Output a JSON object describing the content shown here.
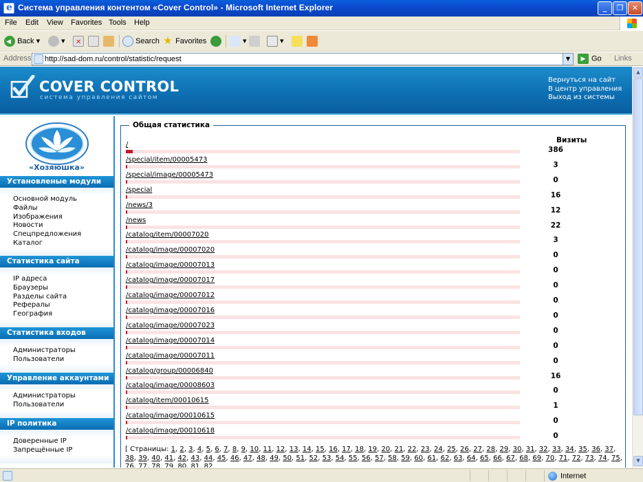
{
  "window": {
    "title": "Система управления контентом «Cover Control» - Microsoft Internet Explorer"
  },
  "menu": [
    "File",
    "Edit",
    "View",
    "Favorites",
    "Tools",
    "Help"
  ],
  "toolbar": {
    "back": "Back",
    "search": "Search",
    "favorites": "Favorites"
  },
  "address": {
    "label": "Address",
    "url": "http://sad-dom.ru/control/statistic/request",
    "go": "Go",
    "links": "Links"
  },
  "header": {
    "logo_title": "COVER CONTROL",
    "logo_subtitle": "система управления сайтом",
    "links": [
      "Вернуться на сайт",
      "В центр управления",
      "Выход из системы"
    ]
  },
  "sidebar": {
    "brand": "«Хозяюшка»",
    "sections": [
      {
        "title": "Установленые модули",
        "items": [
          "Основной модуль",
          "Файлы",
          "Изображения",
          "Новости",
          "Спецпредложения",
          "Каталог"
        ]
      },
      {
        "title": "Статистика сайта",
        "items": [
          "IP адреса",
          "Браузеры",
          "Разделы сайта",
          "Рефералы",
          "География"
        ]
      },
      {
        "title": "Статистика входов",
        "items": [
          "Администраторы",
          "Пользователи"
        ]
      },
      {
        "title": "Управление аккаунтами",
        "items": [
          "Администраторы",
          "Пользователи"
        ]
      },
      {
        "title": "IP политика",
        "items": [
          "Доверенные IP",
          "Запрещённые IP"
        ]
      }
    ]
  },
  "stats": {
    "title": "Общая статистика",
    "column": "Визиты",
    "max": 386,
    "rows": [
      {
        "path": "/",
        "visits": 386
      },
      {
        "path": "/special/item/00005473",
        "visits": 3
      },
      {
        "path": "/special/image/00005473",
        "visits": 0
      },
      {
        "path": "/special",
        "visits": 16
      },
      {
        "path": "/news/3",
        "visits": 12
      },
      {
        "path": "/news",
        "visits": 22
      },
      {
        "path": "/catalog/item/00007020",
        "visits": 3
      },
      {
        "path": "/catalog/image/00007020",
        "visits": 0
      },
      {
        "path": "/catalog/image/00007013",
        "visits": 0
      },
      {
        "path": "/catalog/image/00007017",
        "visits": 0
      },
      {
        "path": "/catalog/image/00007012",
        "visits": 0
      },
      {
        "path": "/catalog/image/00007016",
        "visits": 0
      },
      {
        "path": "/catalog/image/00007023",
        "visits": 0
      },
      {
        "path": "/catalog/image/00007014",
        "visits": 0
      },
      {
        "path": "/catalog/image/00007011",
        "visits": 0
      },
      {
        "path": "/catalog/group/00006840",
        "visits": 16
      },
      {
        "path": "/catalog/image/00008603",
        "visits": 0
      },
      {
        "path": "/catalog/item/00010615",
        "visits": 1
      },
      {
        "path": "/catalog/image/00010615",
        "visits": 0
      },
      {
        "path": "/catalog/image/00010618",
        "visits": 0
      }
    ],
    "pager_label": "[ Страницы:",
    "pages": [
      "1",
      "2",
      "3",
      "4",
      "5",
      "6",
      "7",
      "8",
      "9",
      "10",
      "11",
      "12",
      "13",
      "14",
      "15",
      "16",
      "17",
      "18",
      "19",
      "20",
      "21",
      "22",
      "23",
      "24",
      "25",
      "26",
      "27",
      "28",
      "29",
      "30",
      "31",
      "32",
      "33",
      "34",
      "35",
      "36",
      "37",
      "38",
      "39",
      "40",
      "41",
      "42",
      "43",
      "44",
      "45",
      "46",
      "47",
      "48",
      "49",
      "50",
      "51",
      "52",
      "53",
      "54",
      "55",
      "56",
      "57",
      "58",
      "59",
      "60",
      "61",
      "62",
      "63",
      "64",
      "65",
      "66",
      "67",
      "68",
      "69",
      "70",
      "71",
      "72",
      "73",
      "74",
      "75",
      "76",
      "77",
      "78",
      "79",
      "80",
      "81",
      "82"
    ]
  },
  "status": {
    "zone": "Internet"
  }
}
